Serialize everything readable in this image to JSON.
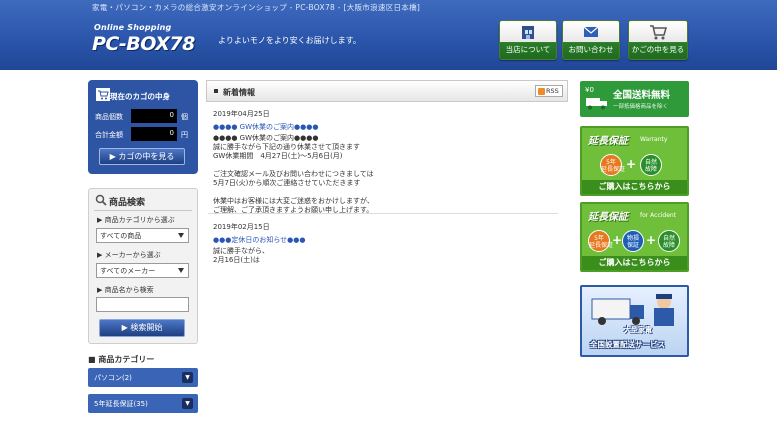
{
  "header": {
    "tagline": "家電・パソコン・カメラの総合激安オンラインショップ - PC-BOX78 - [大阪市浪速区日本橋]",
    "logo_top": "Online Shopping",
    "logo_main": "PC-BOX78",
    "slogan": "よりよいモノをより安くお届けします。",
    "buttons": [
      {
        "label": "当店について",
        "icon": "shop-icon"
      },
      {
        "label": "お問い合わせ",
        "icon": "mail-icon"
      },
      {
        "label": "かごの中を見る",
        "icon": "cart-icon"
      }
    ]
  },
  "cart": {
    "title": "現在のカゴの中身",
    "count_label": "商品個数",
    "count_value": "0",
    "count_unit": "個",
    "total_label": "合計金額",
    "total_value": "0",
    "total_unit": "円",
    "view_button": "カゴの中を見る"
  },
  "search": {
    "title": "商品検索",
    "category_label": "商品カテゴリから選ぶ",
    "category_value": "すべての商品",
    "maker_label": "メーカーから選ぶ",
    "maker_value": "すべてのメーカー",
    "name_label": "商品名から検索",
    "submit": "検索開始"
  },
  "categories": {
    "title": "商品カテゴリー",
    "items": [
      {
        "label": "パソコン(2)"
      },
      {
        "label": "5年延長保証(35)"
      }
    ]
  },
  "news": {
    "title": "新着情報",
    "rss": "RSS",
    "entries": [
      {
        "date": "2019年04月25日",
        "link": "●●●● GW休業のご案内●●●●",
        "body": "●●●● GW休業のご案内●●●●\n誠に勝手ながら下記の通り休業させて頂きます\nGW休業期間　4月27日(土)～5月6日(月)\n\nご注文確認メール及びお問い合わせにつきましては\n5月7日(火)から順次ご連絡させていただきます\n\n休業中はお客様には大変ご迷惑をおかけしますが、\nご理解、ご了承頂きますようお願い申し上げます。"
      },
      {
        "date": "2019年02月15日",
        "link": "●●●定休日のお知らせ●●●",
        "body": "誠に勝手ながら、\n2月16日(土)は"
      }
    ]
  },
  "banners": {
    "free_shipping": {
      "yen": "¥0",
      "title": "全国送料無料",
      "note": "一部抵価格商品を除く"
    },
    "warranty1": {
      "title": "延長保証",
      "sub": "Warranty",
      "c1": "5年\n延長保証",
      "c2": "自然\n故障",
      "buy": "ご購入はこちらから"
    },
    "warranty2": {
      "title": "延長保証",
      "sub": "for Accident",
      "c1": "5年\n延長保証",
      "c2": "物損\n保証",
      "c3": "自然\n故障",
      "buy": "ご購入はこちらから"
    },
    "delivery": {
      "line1": "大型家電",
      "line2": "全国設置配送サービス"
    }
  }
}
